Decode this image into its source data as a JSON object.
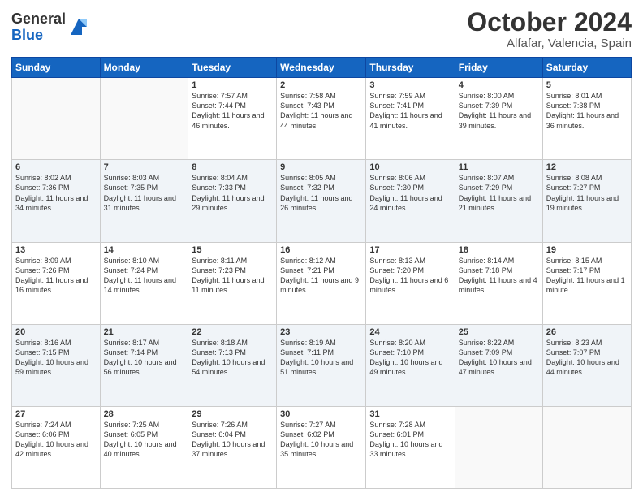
{
  "logo": {
    "general": "General",
    "blue": "Blue"
  },
  "header": {
    "month": "October 2024",
    "location": "Alfafar, Valencia, Spain"
  },
  "weekdays": [
    "Sunday",
    "Monday",
    "Tuesday",
    "Wednesday",
    "Thursday",
    "Friday",
    "Saturday"
  ],
  "weeks": [
    [
      {
        "day": "",
        "info": ""
      },
      {
        "day": "",
        "info": ""
      },
      {
        "day": "1",
        "info": "Sunrise: 7:57 AM\nSunset: 7:44 PM\nDaylight: 11 hours and 46 minutes."
      },
      {
        "day": "2",
        "info": "Sunrise: 7:58 AM\nSunset: 7:43 PM\nDaylight: 11 hours and 44 minutes."
      },
      {
        "day": "3",
        "info": "Sunrise: 7:59 AM\nSunset: 7:41 PM\nDaylight: 11 hours and 41 minutes."
      },
      {
        "day": "4",
        "info": "Sunrise: 8:00 AM\nSunset: 7:39 PM\nDaylight: 11 hours and 39 minutes."
      },
      {
        "day": "5",
        "info": "Sunrise: 8:01 AM\nSunset: 7:38 PM\nDaylight: 11 hours and 36 minutes."
      }
    ],
    [
      {
        "day": "6",
        "info": "Sunrise: 8:02 AM\nSunset: 7:36 PM\nDaylight: 11 hours and 34 minutes."
      },
      {
        "day": "7",
        "info": "Sunrise: 8:03 AM\nSunset: 7:35 PM\nDaylight: 11 hours and 31 minutes."
      },
      {
        "day": "8",
        "info": "Sunrise: 8:04 AM\nSunset: 7:33 PM\nDaylight: 11 hours and 29 minutes."
      },
      {
        "day": "9",
        "info": "Sunrise: 8:05 AM\nSunset: 7:32 PM\nDaylight: 11 hours and 26 minutes."
      },
      {
        "day": "10",
        "info": "Sunrise: 8:06 AM\nSunset: 7:30 PM\nDaylight: 11 hours and 24 minutes."
      },
      {
        "day": "11",
        "info": "Sunrise: 8:07 AM\nSunset: 7:29 PM\nDaylight: 11 hours and 21 minutes."
      },
      {
        "day": "12",
        "info": "Sunrise: 8:08 AM\nSunset: 7:27 PM\nDaylight: 11 hours and 19 minutes."
      }
    ],
    [
      {
        "day": "13",
        "info": "Sunrise: 8:09 AM\nSunset: 7:26 PM\nDaylight: 11 hours and 16 minutes."
      },
      {
        "day": "14",
        "info": "Sunrise: 8:10 AM\nSunset: 7:24 PM\nDaylight: 11 hours and 14 minutes."
      },
      {
        "day": "15",
        "info": "Sunrise: 8:11 AM\nSunset: 7:23 PM\nDaylight: 11 hours and 11 minutes."
      },
      {
        "day": "16",
        "info": "Sunrise: 8:12 AM\nSunset: 7:21 PM\nDaylight: 11 hours and 9 minutes."
      },
      {
        "day": "17",
        "info": "Sunrise: 8:13 AM\nSunset: 7:20 PM\nDaylight: 11 hours and 6 minutes."
      },
      {
        "day": "18",
        "info": "Sunrise: 8:14 AM\nSunset: 7:18 PM\nDaylight: 11 hours and 4 minutes."
      },
      {
        "day": "19",
        "info": "Sunrise: 8:15 AM\nSunset: 7:17 PM\nDaylight: 11 hours and 1 minute."
      }
    ],
    [
      {
        "day": "20",
        "info": "Sunrise: 8:16 AM\nSunset: 7:15 PM\nDaylight: 10 hours and 59 minutes."
      },
      {
        "day": "21",
        "info": "Sunrise: 8:17 AM\nSunset: 7:14 PM\nDaylight: 10 hours and 56 minutes."
      },
      {
        "day": "22",
        "info": "Sunrise: 8:18 AM\nSunset: 7:13 PM\nDaylight: 10 hours and 54 minutes."
      },
      {
        "day": "23",
        "info": "Sunrise: 8:19 AM\nSunset: 7:11 PM\nDaylight: 10 hours and 51 minutes."
      },
      {
        "day": "24",
        "info": "Sunrise: 8:20 AM\nSunset: 7:10 PM\nDaylight: 10 hours and 49 minutes."
      },
      {
        "day": "25",
        "info": "Sunrise: 8:22 AM\nSunset: 7:09 PM\nDaylight: 10 hours and 47 minutes."
      },
      {
        "day": "26",
        "info": "Sunrise: 8:23 AM\nSunset: 7:07 PM\nDaylight: 10 hours and 44 minutes."
      }
    ],
    [
      {
        "day": "27",
        "info": "Sunrise: 7:24 AM\nSunset: 6:06 PM\nDaylight: 10 hours and 42 minutes."
      },
      {
        "day": "28",
        "info": "Sunrise: 7:25 AM\nSunset: 6:05 PM\nDaylight: 10 hours and 40 minutes."
      },
      {
        "day": "29",
        "info": "Sunrise: 7:26 AM\nSunset: 6:04 PM\nDaylight: 10 hours and 37 minutes."
      },
      {
        "day": "30",
        "info": "Sunrise: 7:27 AM\nSunset: 6:02 PM\nDaylight: 10 hours and 35 minutes."
      },
      {
        "day": "31",
        "info": "Sunrise: 7:28 AM\nSunset: 6:01 PM\nDaylight: 10 hours and 33 minutes."
      },
      {
        "day": "",
        "info": ""
      },
      {
        "day": "",
        "info": ""
      }
    ]
  ]
}
